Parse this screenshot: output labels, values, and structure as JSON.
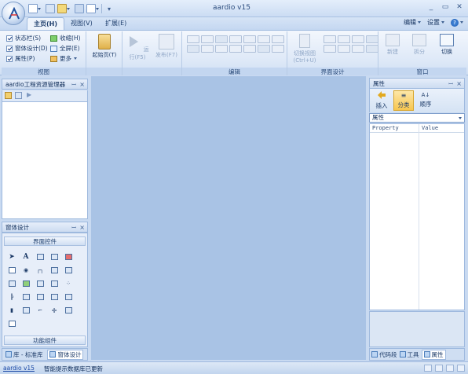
{
  "window": {
    "title": "aardio v15",
    "controls": [
      "_",
      "▭",
      "✕"
    ]
  },
  "ribbon_tabs": {
    "home": "主页(H)",
    "view": "视图(V)",
    "extend": "扩展(E)"
  },
  "tab_right": {
    "edit": "编辑",
    "settings": "设置",
    "help": "?"
  },
  "view_group": {
    "label": "视图",
    "status_bar": "状态栏(S)",
    "form_designer": "窗体设计(D)",
    "properties": "属性(P)",
    "favorites": "收缩(H)",
    "fullscreen": "全屏(E)",
    "more": "更多"
  },
  "clipboard_group": {
    "start_page": "起始页(T)"
  },
  "run_group": {
    "run": "运行(F5)",
    "publish": "发布(F7)"
  },
  "edit_group": {
    "label": "编辑"
  },
  "ui_group": {
    "label": "界面设计",
    "switch_view": "切换视图",
    "switch_shortcut": "(Ctrl+U)"
  },
  "window_group": {
    "label": "窗口",
    "new": "新建",
    "split": "拆分",
    "switch": "切换"
  },
  "project_panel": {
    "title": "aardio工程资源管理器"
  },
  "form_panel": {
    "title": "窗体设计",
    "section_controls": "界面控件",
    "section_functions": "功能组件"
  },
  "left_tabs": {
    "library": "库 - 标准库",
    "form": "窗体设计"
  },
  "props_panel": {
    "title": "属性",
    "insert": "插入",
    "categorize": "分类",
    "sort": "顺序",
    "selected": "属性",
    "col_property": "Property",
    "col_value": "Value"
  },
  "right_tabs": {
    "code": "代码段",
    "tools": "工具",
    "props": "属性"
  },
  "status": {
    "link": "aardio v15",
    "message": "智能提示数据库已更新"
  },
  "colors": {
    "accent": "#1f5cb3",
    "main_bg": "#a9c3e5"
  }
}
